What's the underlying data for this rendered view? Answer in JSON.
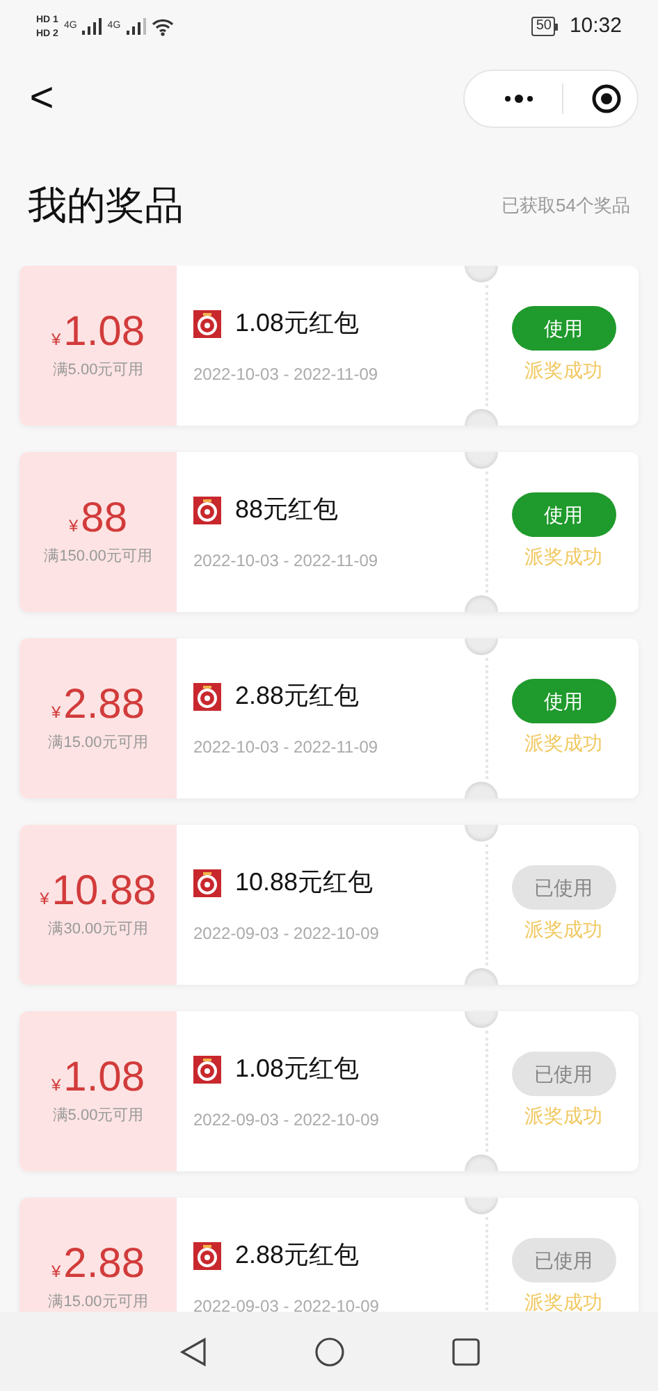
{
  "status_bar": {
    "sim_1": "HD 1",
    "sim_2": "HD 2",
    "network_1": "4G",
    "network_2": "4G",
    "battery": "50",
    "time": "10:32"
  },
  "header": {
    "back": "<",
    "title": "我的奖品",
    "count": "已获取54个奖品"
  },
  "coupons": [
    {
      "currency": "¥",
      "amount": "1.08",
      "condition": "满5.00元可用",
      "title": "1.08元红包",
      "dates": "2022-10-03 - 2022-11-09",
      "button": "使用",
      "used": false,
      "status": "派奖成功"
    },
    {
      "currency": "¥",
      "amount": "88",
      "condition": "满150.00元可用",
      "title": "88元红包",
      "dates": "2022-10-03 - 2022-11-09",
      "button": "使用",
      "used": false,
      "status": "派奖成功"
    },
    {
      "currency": "¥",
      "amount": "2.88",
      "condition": "满15.00元可用",
      "title": "2.88元红包",
      "dates": "2022-10-03 - 2022-11-09",
      "button": "使用",
      "used": false,
      "status": "派奖成功"
    },
    {
      "currency": "¥",
      "amount": "10.88",
      "condition": "满30.00元可用",
      "title": "10.88元红包",
      "dates": "2022-09-03 - 2022-10-09",
      "button": "已使用",
      "used": true,
      "status": "派奖成功"
    },
    {
      "currency": "¥",
      "amount": "1.08",
      "condition": "满5.00元可用",
      "title": "1.08元红包",
      "dates": "2022-09-03 - 2022-10-09",
      "button": "已使用",
      "used": true,
      "status": "派奖成功"
    },
    {
      "currency": "¥",
      "amount": "2.88",
      "condition": "满15.00元可用",
      "title": "2.88元红包",
      "dates": "2022-09-03 - 2022-10-09",
      "button": "已使用",
      "used": true,
      "status": "派奖成功"
    }
  ]
}
